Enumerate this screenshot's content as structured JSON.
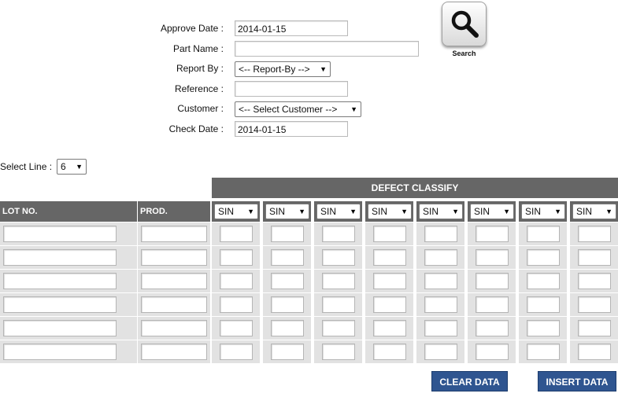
{
  "form": {
    "approve_date": {
      "label": "Approve Date :",
      "value": "2014-01-15"
    },
    "part_name": {
      "label": "Part Name :",
      "value": ""
    },
    "report_by": {
      "label": "Report By :",
      "selected": "<-- Report-By -->"
    },
    "reference": {
      "label": "Reference :",
      "value": ""
    },
    "customer": {
      "label": "Customer :",
      "selected": "<-- Select Customer -->"
    },
    "check_date": {
      "label": "Check Date :",
      "value": "2014-01-15"
    }
  },
  "search": {
    "caption": "Search",
    "icon": "magnifier-icon"
  },
  "select_line": {
    "label": "Select Line :",
    "selected": "6"
  },
  "table": {
    "defect_header": "DEFECT CLASSIFY",
    "lot_header": "LOT NO.",
    "prod_header": "PROD.",
    "defect_columns": [
      "SIN",
      "SIN",
      "SIN",
      "SIN",
      "SIN",
      "SIN",
      "SIN",
      "SIN"
    ],
    "row_count": 6
  },
  "buttons": {
    "clear": "CLEAR DATA",
    "insert": "INSERT DATA"
  },
  "colors": {
    "header_bg": "#666666",
    "cell_bg": "#e2e2e2",
    "button_bg": "#2f5590"
  }
}
